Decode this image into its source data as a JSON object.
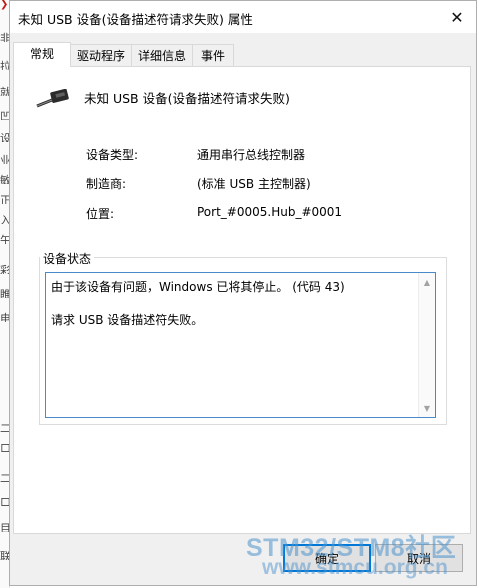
{
  "window": {
    "title": "未知 USB 设备(设备描述符请求失败) 属性",
    "close_symbol": "✕"
  },
  "tabs": [
    {
      "label": "常规",
      "active": true
    },
    {
      "label": "驱动程序",
      "active": false
    },
    {
      "label": "详细信息",
      "active": false
    },
    {
      "label": "事件",
      "active": false
    }
  ],
  "device": {
    "icon": "usb-device-icon",
    "name": "未知 USB 设备(设备描述符请求失败)"
  },
  "properties": [
    {
      "label": "设备类型:",
      "value": "通用串行总线控制器"
    },
    {
      "label": "制造商:",
      "value": "(标准 USB 主控制器)"
    },
    {
      "label": "位置:",
      "value": "Port_#0005.Hub_#0001"
    }
  ],
  "status": {
    "group_label": "设备状态",
    "line1": "由于该设备有问题，Windows 已将其停止。 (代码 43)",
    "line2": "请求 USB 设备描述符失败。"
  },
  "buttons": {
    "ok": "确定",
    "cancel": "取消"
  },
  "watermark": {
    "text": "STM32/STM8社区",
    "url": "www.stmcu.org.cn"
  },
  "background_glyphs": [
    "❯",
    "非",
    "拉",
    "就",
    "凹",
    "设",
    "业",
    "敏",
    "正",
    "入",
    "午",
    "彩",
    "睢",
    "电",
    "二",
    "口",
    "二",
    "口",
    "目",
    "联"
  ],
  "colors": {
    "focus_blue": "#0078d7",
    "watermark_blue": "#4f94ce"
  }
}
